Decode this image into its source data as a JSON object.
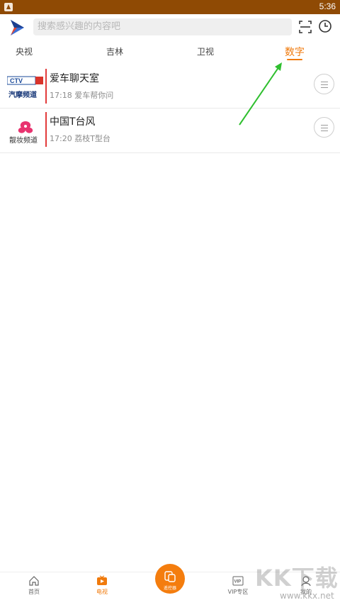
{
  "status_bar": {
    "time": "5:36"
  },
  "search": {
    "placeholder": "搜索感兴趣的内容吧"
  },
  "tabs": [
    {
      "label": "央视"
    },
    {
      "label": "吉林"
    },
    {
      "label": "卫视"
    },
    {
      "label": "数字",
      "active": true
    }
  ],
  "channels": [
    {
      "logo_text_top": "CTV",
      "logo_text_bottom": "汽摩频道",
      "program": "爱车聊天室",
      "time": "17:18",
      "next": "爱车帮你问"
    },
    {
      "logo_text_bottom": "靓妆频道",
      "program": "中国T台风",
      "time": "17:20",
      "next": "荔枝T型台"
    }
  ],
  "bottom_nav": [
    {
      "label": "首页"
    },
    {
      "label": "电视",
      "active": true
    },
    {
      "label": "遥控器"
    },
    {
      "label": "VIP专区"
    },
    {
      "label": "我的"
    }
  ],
  "watermark": {
    "brand": "KK下载",
    "url": "www.kkx.net"
  },
  "colors": {
    "accent": "#f07a0c",
    "status_bar": "#8f4a04",
    "channel_bar": "#e23b3b",
    "arrow": "#2fbf2f"
  }
}
